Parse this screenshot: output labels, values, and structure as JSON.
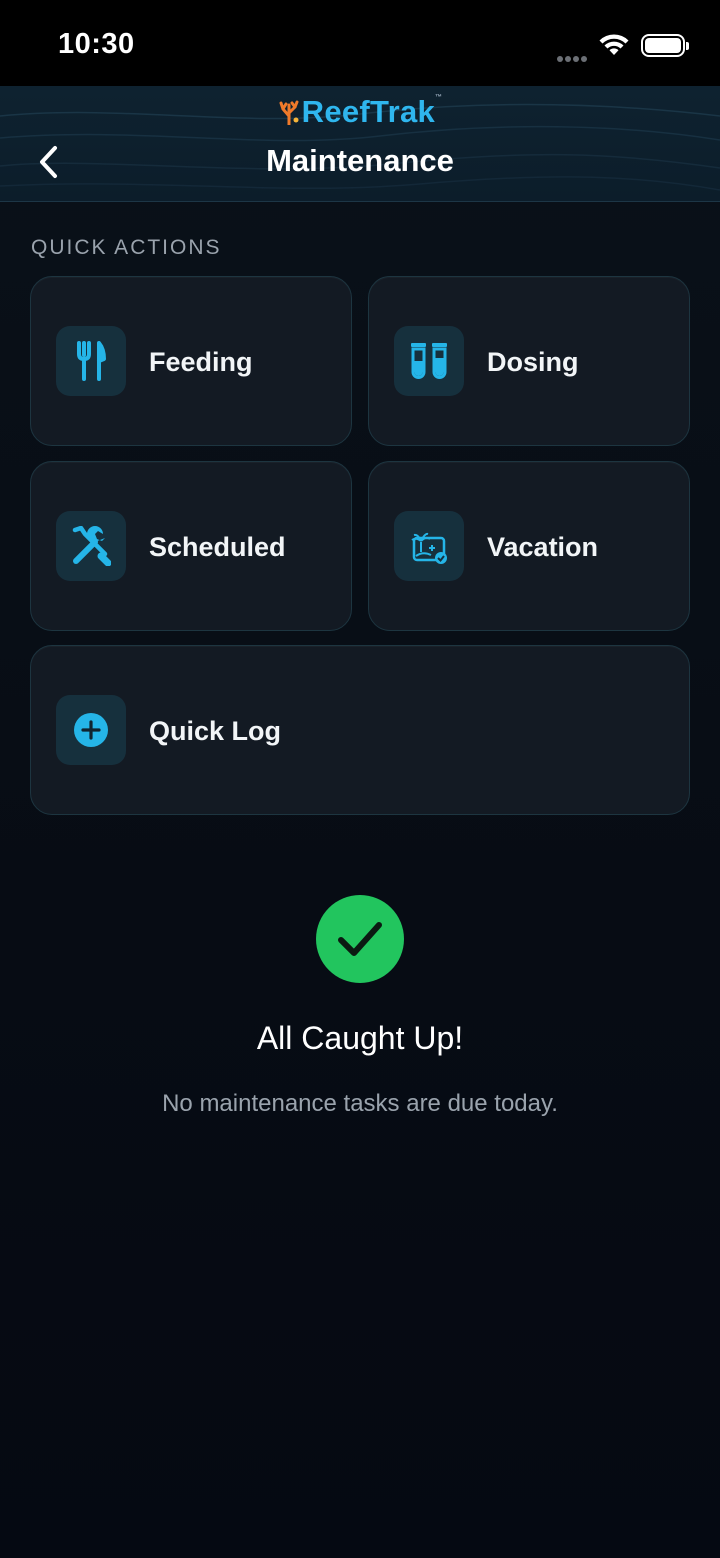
{
  "status_bar": {
    "time": "10:30"
  },
  "header": {
    "brand": "ReefTrak",
    "brand_mark": "™",
    "title": "Maintenance"
  },
  "quick_actions": {
    "section_label": "QUICK ACTIONS",
    "items": [
      {
        "label": "Feeding",
        "icon": "fork-knife-icon"
      },
      {
        "label": "Dosing",
        "icon": "test-tubes-icon"
      },
      {
        "label": "Scheduled",
        "icon": "wrench-screwdriver-icon"
      },
      {
        "label": "Vacation",
        "icon": "palm-tree-icon"
      },
      {
        "label": "Quick Log",
        "icon": "plus-circle-icon"
      }
    ]
  },
  "empty_state": {
    "title": "All Caught Up!",
    "subtitle": "No maintenance tasks are due today."
  },
  "colors": {
    "accent": "#2fb6ee",
    "success": "#22c55e",
    "background": "#070b12",
    "card": "#131a23"
  }
}
